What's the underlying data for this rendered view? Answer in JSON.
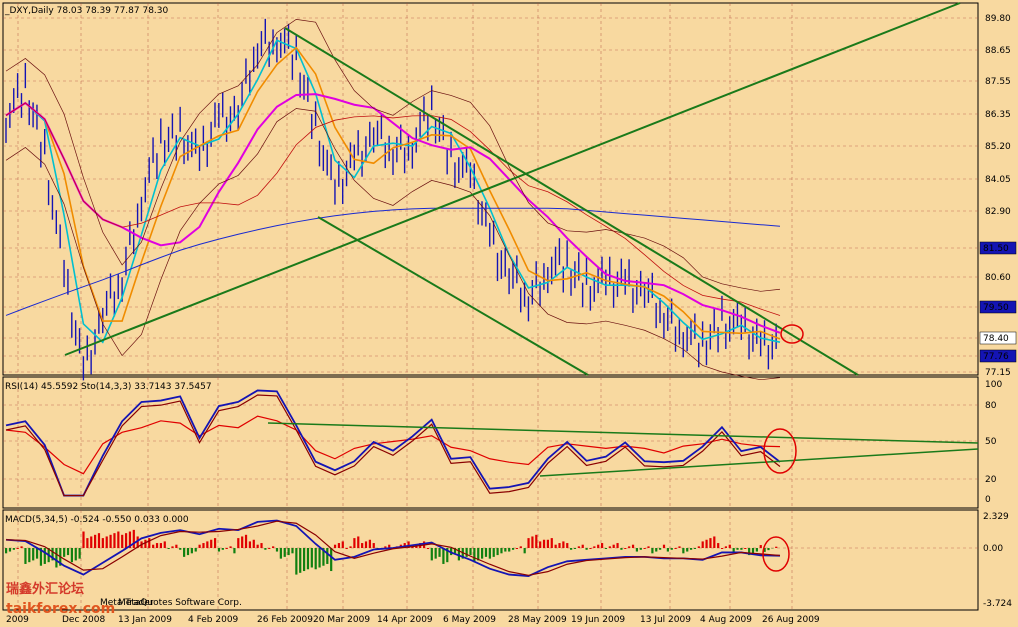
{
  "colors": {
    "background": "#f8d9a0",
    "grid": "#b0453a",
    "price": "#1414b4",
    "ma_fast": "#00c0d0",
    "ma_orange": "#f08c00",
    "ma_magenta": "#e000e0",
    "ma_red": "#c01010",
    "ma_blue": "#1a2ad0",
    "bollinger": "#6a1010",
    "trend": "#1a7a1a",
    "circle": "#e00000",
    "macd_up": "#e00000",
    "macd_down": "#108010"
  },
  "main": {
    "header": "_DXY,Daily  78.03 78.39 77.87 78.30",
    "price_ticks": [
      "89.80",
      "88.65",
      "87.55",
      "86.35",
      "85.20",
      "84.05",
      "82.90",
      "81.50",
      "80.60",
      "79.50",
      "78.40",
      "77.76",
      "77.15"
    ],
    "boxed_ticks": [
      "81.50",
      "79.50",
      "78.40",
      "77.76"
    ]
  },
  "rsi_panel": {
    "header": "RSI(14) 45.5592  Sto(14,3,3) 33.7143 37.5457",
    "ticks": [
      "100",
      "80",
      "50",
      "20",
      "0"
    ]
  },
  "macd_panel": {
    "header": "MACD(5,34,5) -0.524 -0.550 0.033 0.000",
    "ticks": [
      "2.329",
      "0.00",
      "-3.724"
    ]
  },
  "dates": [
    "13 Jan 2009",
    "4 Feb 2009",
    "26 Feb 2009",
    "20 Mar 2009",
    "14 Apr 2009",
    "6 May 2009",
    "28 May 2009",
    "19 Jun 2009",
    "13 Jul 2009",
    "4 Aug 2009",
    "26 Aug 2009"
  ],
  "date_partial": [
    "2009",
    "Dec 2008"
  ],
  "watermark": {
    "chinese": "瑞鑫外汇论坛",
    "site": "taikforex.com",
    "copyright": "MetaQuotes Software Corp.",
    "prefix": "Meta Trader"
  },
  "chart_data": {
    "type": "line",
    "symbol": "_DXY",
    "timeframe": "Daily",
    "ohlc_last": {
      "open": 78.03,
      "high": 78.39,
      "low": 77.87,
      "close": 78.3
    },
    "x": [
      "2008-11-20",
      "2008-11-27",
      "2008-12-04",
      "2008-12-11",
      "2008-12-18",
      "2008-12-25",
      "2009-01-01",
      "2009-01-08",
      "2009-01-15",
      "2009-01-22",
      "2009-01-29",
      "2009-02-05",
      "2009-02-12",
      "2009-02-19",
      "2009-02-26",
      "2009-03-05",
      "2009-03-12",
      "2009-03-19",
      "2009-03-26",
      "2009-04-02",
      "2009-04-09",
      "2009-04-16",
      "2009-04-23",
      "2009-04-30",
      "2009-05-07",
      "2009-05-14",
      "2009-05-21",
      "2009-05-28",
      "2009-06-04",
      "2009-06-11",
      "2009-06-18",
      "2009-06-25",
      "2009-07-02",
      "2009-07-09",
      "2009-07-16",
      "2009-07-23",
      "2009-07-30",
      "2009-08-06",
      "2009-08-13",
      "2009-08-20",
      "2009-08-27"
    ],
    "series": [
      {
        "name": "price",
        "values": [
          86.3,
          87.2,
          85.0,
          80.5,
          77.3,
          79.2,
          80.5,
          83.5,
          85.2,
          85.8,
          84.6,
          86.3,
          86.4,
          88.8,
          89.2,
          88.2,
          86.0,
          83.4,
          84.8,
          85.6,
          85.0,
          85.4,
          86.4,
          84.9,
          84.0,
          82.0,
          80.6,
          79.8,
          81.0,
          80.8,
          80.4,
          80.2,
          80.4,
          80.1,
          79.2,
          78.7,
          78.0,
          79.1,
          78.6,
          78.2,
          78.3
        ]
      },
      {
        "name": "RSI(14)",
        "values": [
          60,
          58,
          45,
          30,
          22,
          48,
          58,
          62,
          68,
          66,
          55,
          64,
          62,
          72,
          68,
          60,
          42,
          35,
          44,
          48,
          50,
          52,
          55,
          45,
          42,
          35,
          32,
          30,
          45,
          48,
          46,
          44,
          46,
          44,
          40,
          46,
          48,
          52,
          48,
          46,
          45.56
        ]
      },
      {
        "name": "MACD(5,34,5)",
        "values": [
          0.6,
          0.5,
          -0.3,
          -1.2,
          -1.8,
          -1.0,
          -0.2,
          0.7,
          1.1,
          1.3,
          1.0,
          1.4,
          1.3,
          1.9,
          2.0,
          1.6,
          0.3,
          -0.8,
          -0.6,
          -0.1,
          0.0,
          0.2,
          0.4,
          -0.3,
          -0.8,
          -1.4,
          -1.8,
          -1.9,
          -1.3,
          -0.9,
          -0.8,
          -0.7,
          -0.6,
          -0.6,
          -0.7,
          -0.7,
          -0.8,
          -0.3,
          -0.3,
          -0.5,
          -0.52
        ]
      }
    ],
    "indicators": {
      "rsi": {
        "period": 14,
        "value": 45.5592
      },
      "stochastic": {
        "params": "14,3,3",
        "k": 33.7143,
        "d": 37.5457
      },
      "macd": {
        "params": "5,34,5",
        "values": [
          -0.524,
          -0.55,
          0.033,
          0.0
        ]
      }
    },
    "ylim": [
      77.15,
      89.8
    ],
    "rsi_ylim": [
      0,
      100
    ],
    "macd_ylim": [
      -3.724,
      2.329
    ],
    "grid": true
  }
}
